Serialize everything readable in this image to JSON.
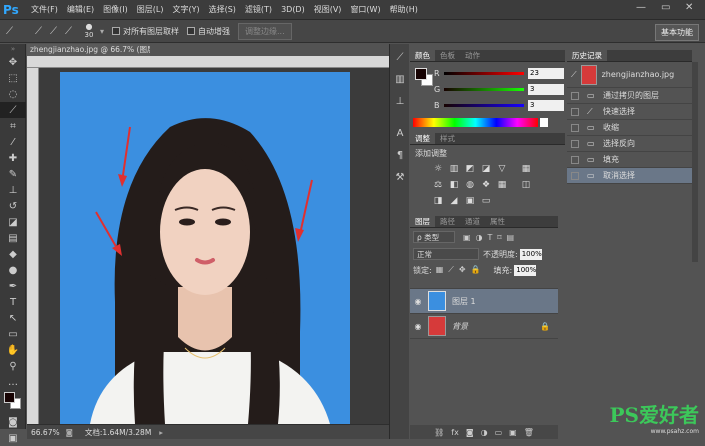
{
  "menubar": {
    "logo": "Ps",
    "items": [
      "文件(F)",
      "编辑(E)",
      "图像(I)",
      "图层(L)",
      "文字(Y)",
      "选择(S)",
      "滤镜(T)",
      "3D(D)",
      "视图(V)",
      "窗口(W)",
      "帮助(H)"
    ]
  },
  "options": {
    "brush_size": "30",
    "sample_all": "对所有图层取样",
    "auto_enhance": "自动增强",
    "refine_edge": "调整边缘...",
    "workspace": "基本功能"
  },
  "document": {
    "tab_title": "zhengjianzhao.jpg @ 66.7% (图层 1, RGB/8#) *",
    "zoom": "66.67%",
    "doc_size": "文档:1.64M/3.28M"
  },
  "color_panel": {
    "tabs": [
      "颜色",
      "色板",
      "动作"
    ],
    "r_label": "R",
    "g_label": "G",
    "b_label": "B",
    "r": "23",
    "g": "3",
    "b": "3"
  },
  "adjust_panel": {
    "tabs": [
      "调整",
      "样式"
    ],
    "title": "添加调整"
  },
  "layers_panel": {
    "tabs": [
      "图层",
      "路径",
      "通道",
      "属性"
    ],
    "filter": "ρ 类型",
    "blend_mode": "正常",
    "opacity_label": "不透明度:",
    "opacity": "100%",
    "lock_label": "锁定:",
    "fill_label": "填充:",
    "fill": "100%",
    "layers": [
      {
        "name": "图层 1"
      },
      {
        "name": "背景"
      }
    ]
  },
  "history_panel": {
    "title": "历史记录",
    "snapshot": "zhengjianzhao.jpg",
    "items": [
      "通过拷贝的图层",
      "快速选择",
      "收缩",
      "选择反向",
      "填充",
      "取消选择"
    ]
  },
  "watermark": {
    "text": "PS爱好者",
    "url": "www.psahz.com"
  }
}
